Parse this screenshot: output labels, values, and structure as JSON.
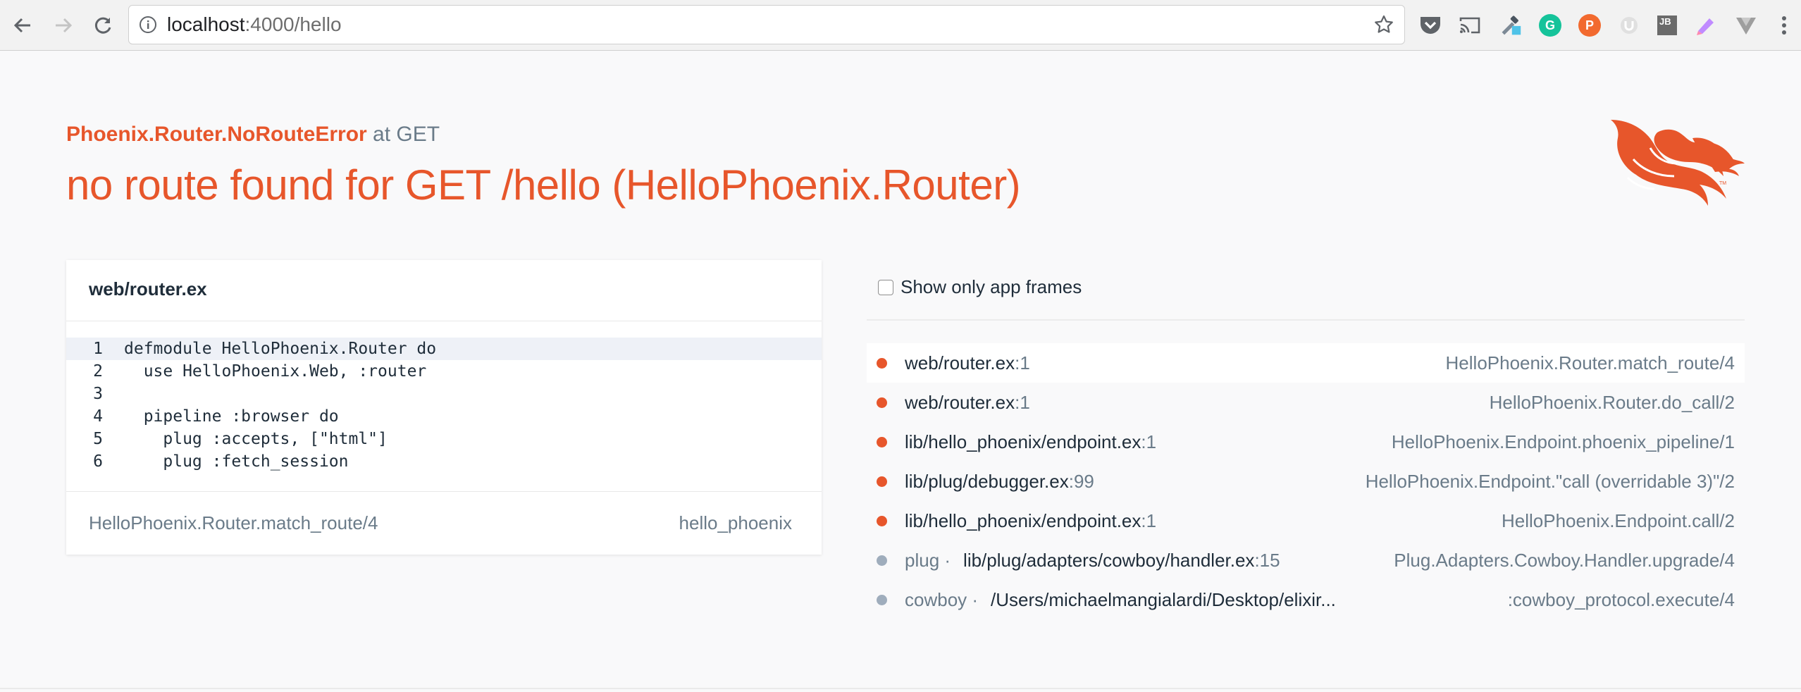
{
  "browser": {
    "url_host": "localhost",
    "url_rest": ":4000/hello",
    "icons": [
      "back-icon",
      "forward-icon",
      "reload-icon",
      "info-icon",
      "bookmark-star-icon",
      "pocket-icon",
      "cast-icon",
      "color-picker-icon",
      "grammarly-icon",
      "producthunt-icon",
      "ublock-icon",
      "jetbrains-icon",
      "extension-icon",
      "vue-devtools-icon"
    ],
    "ext_letters": {
      "grammarly": "G",
      "producthunt": "P",
      "jetbrains": "JB"
    },
    "accent": "#e7562b"
  },
  "error": {
    "type": "Phoenix.Router.NoRouteError",
    "at": " at GET",
    "message": "no route found for GET /hello (HelloPhoenix.Router)"
  },
  "code_card": {
    "file": "web/router.ex",
    "lines": [
      {
        "n": "1",
        "code": "defmodule HelloPhoenix.Router do",
        "highlight": true
      },
      {
        "n": "2",
        "code": "  use HelloPhoenix.Web, :router",
        "highlight": false
      },
      {
        "n": "3",
        "code": "",
        "highlight": false
      },
      {
        "n": "4",
        "code": "  pipeline :browser do",
        "highlight": false
      },
      {
        "n": "5",
        "code": "    plug :accepts, [\"html\"]",
        "highlight": false
      },
      {
        "n": "6",
        "code": "    plug :fetch_session",
        "highlight": false
      }
    ],
    "function": "HelloPhoenix.Router.match_route/4",
    "app": "hello_phoenix"
  },
  "frames": {
    "toggle_label": "Show only app frames",
    "items": [
      {
        "app": "",
        "file": "web/router.ex",
        "line": ":1",
        "fn": "HelloPhoenix.Router.match_route/4",
        "kind": "app",
        "active": true
      },
      {
        "app": "",
        "file": "web/router.ex",
        "line": ":1",
        "fn": "HelloPhoenix.Router.do_call/2",
        "kind": "app",
        "active": false
      },
      {
        "app": "",
        "file": "lib/hello_phoenix/endpoint.ex",
        "line": ":1",
        "fn": "HelloPhoenix.Endpoint.phoenix_pipeline/1",
        "kind": "app",
        "active": false
      },
      {
        "app": "",
        "file": "lib/plug/debugger.ex",
        "line": ":99",
        "fn": "HelloPhoenix.Endpoint.\"call (overridable 3)\"/2",
        "kind": "app",
        "active": false
      },
      {
        "app": "",
        "file": "lib/hello_phoenix/endpoint.ex",
        "line": ":1",
        "fn": "HelloPhoenix.Endpoint.call/2",
        "kind": "app",
        "active": false
      },
      {
        "app": "plug ·",
        "file": "lib/plug/adapters/cowboy/handler.ex",
        "line": ":15",
        "fn": "Plug.Adapters.Cowboy.Handler.upgrade/4",
        "kind": "dep",
        "active": false
      },
      {
        "app": "cowboy ·",
        "file": "/Users/michaelmangialardi/Desktop/elixir...",
        "line": "",
        "fn": ":cowboy_protocol.execute/4",
        "kind": "dep",
        "active": false
      }
    ]
  }
}
